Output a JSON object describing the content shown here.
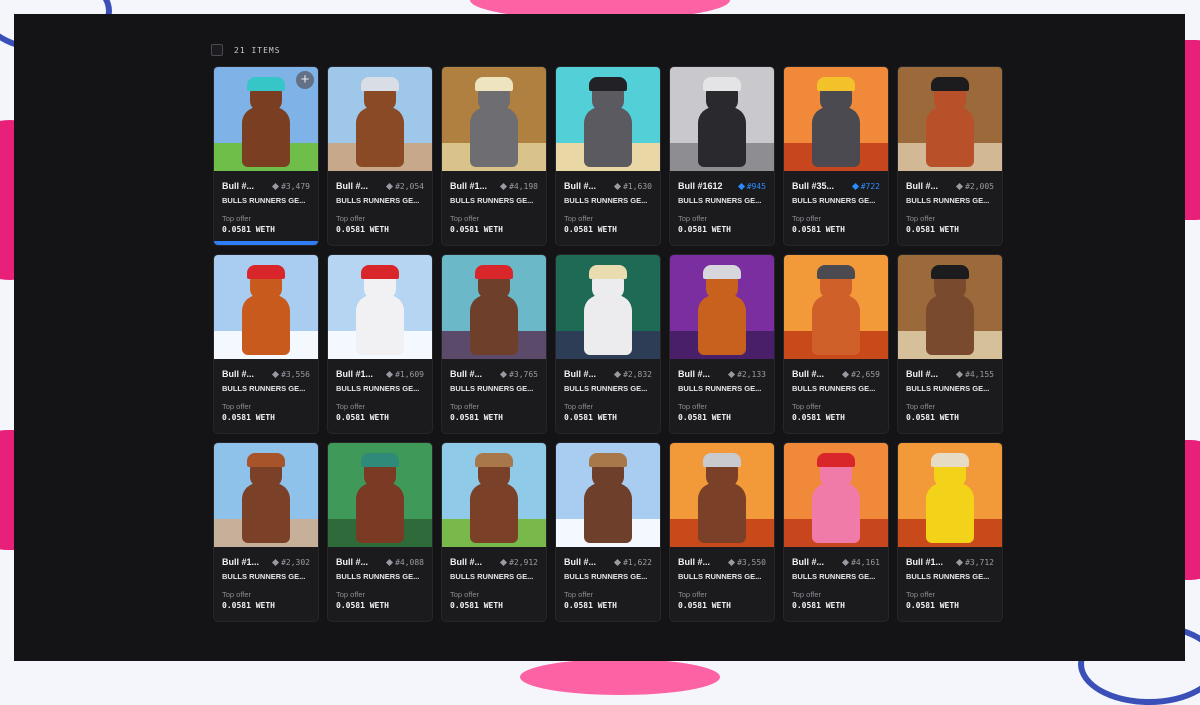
{
  "toolbar": {
    "items_count": "21 ITEMS"
  },
  "colors": {
    "accent": "#2e7cf6",
    "rank_blue": "#2b8cff",
    "frame_pink": "#e8207a"
  },
  "icons": {
    "add": "plus-icon",
    "rank": "diamond-icon"
  },
  "cards": [
    {
      "name": "Bull #...",
      "rank": "#3,479",
      "collection": "BULLS RUNNERS GE...",
      "offer_label": "Top offer",
      "offer_value": "0.0581 WETH",
      "bg": "#7fb3e8",
      "ground": "#6fbe4a",
      "body": "#7a3f22",
      "hat": "#36c6c8",
      "selected": true
    },
    {
      "name": "Bull #...",
      "rank": "#2,054",
      "collection": "BULLS RUNNERS GE...",
      "offer_label": "Top offer",
      "offer_value": "0.0581 WETH",
      "bg": "#9ec7ea",
      "ground": "#c7a88a",
      "body": "#8a4a26",
      "hat": "#d8dde6"
    },
    {
      "name": "Bull #1...",
      "rank": "#4,198",
      "collection": "BULLS RUNNERS GE...",
      "offer_label": "Top offer",
      "offer_value": "0.0581 WETH",
      "bg": "#b08040",
      "ground": "#d9c38a",
      "body": "#6e6e72",
      "hat": "#efe4c0"
    },
    {
      "name": "Bull #...",
      "rank": "#1,630",
      "collection": "BULLS RUNNERS GE...",
      "offer_label": "Top offer",
      "offer_value": "0.0581 WETH",
      "bg": "#53cfd8",
      "ground": "#e9d7a6",
      "body": "#5a5a60",
      "hat": "#222226"
    },
    {
      "name": "Bull #1612",
      "rank": "#945",
      "rank_blue": true,
      "collection": "BULLS RUNNERS GE...",
      "offer_label": "Top offer",
      "offer_value": "0.0581 WETH",
      "bg": "#c9c9cd",
      "ground": "#8d8d92",
      "body": "#2a2a2e",
      "hat": "#e4e4e6"
    },
    {
      "name": "Bull #35...",
      "rank": "#722",
      "rank_blue": true,
      "collection": "BULLS RUNNERS GE...",
      "offer_label": "Top offer",
      "offer_value": "0.0581 WETH",
      "bg": "#f08a3a",
      "ground": "#c8461e",
      "body": "#4a4a50",
      "hat": "#f3c12a"
    },
    {
      "name": "Bull #...",
      "rank": "#2,005",
      "collection": "BULLS RUNNERS GE...",
      "offer_label": "Top offer",
      "offer_value": "0.0581 WETH",
      "bg": "#9c6a3a",
      "ground": "#d2b894",
      "body": "#b8502a",
      "hat": "#1c1c1e"
    },
    {
      "name": "Bull #...",
      "rank": "#3,556",
      "collection": "BULLS RUNNERS GE...",
      "offer_label": "Top offer",
      "offer_value": "0.0581 WETH",
      "bg": "#a9cdf0",
      "ground": "#f4f8ff",
      "body": "#c85a1e",
      "hat": "#d8262a"
    },
    {
      "name": "Bull #1...",
      "rank": "#1,609",
      "collection": "BULLS RUNNERS GE...",
      "offer_label": "Top offer",
      "offer_value": "0.0581 WETH",
      "bg": "#b5d5f2",
      "ground": "#f4f8ff",
      "body": "#f1f1f3",
      "hat": "#d8262a"
    },
    {
      "name": "Bull #...",
      "rank": "#3,765",
      "collection": "BULLS RUNNERS GE...",
      "offer_label": "Top offer",
      "offer_value": "0.0581 WETH",
      "bg": "#6bb8c9",
      "ground": "#5c4a6a",
      "body": "#6e3f2a",
      "hat": "#d8262a"
    },
    {
      "name": "Bull #...",
      "rank": "#2,832",
      "collection": "BULLS RUNNERS GE...",
      "offer_label": "Top offer",
      "offer_value": "0.0581 WETH",
      "bg": "#1f6a55",
      "ground": "#2d3d55",
      "body": "#ececef",
      "hat": "#e8dcb0"
    },
    {
      "name": "Bull #...",
      "rank": "#2,133",
      "collection": "BULLS RUNNERS GE...",
      "offer_label": "Top offer",
      "offer_value": "0.0581 WETH",
      "bg": "#7a2ea0",
      "ground": "#4a1f6a",
      "body": "#c8601e",
      "hat": "#d6d6dc"
    },
    {
      "name": "Bull #...",
      "rank": "#2,659",
      "collection": "BULLS RUNNERS GE...",
      "offer_label": "Top offer",
      "offer_value": "0.0581 WETH",
      "bg": "#f29a3a",
      "ground": "#c84a1a",
      "body": "#d0602a",
      "hat": "#4a4a50"
    },
    {
      "name": "Bull #...",
      "rank": "#4,155",
      "collection": "BULLS RUNNERS GE...",
      "offer_label": "Top offer",
      "offer_value": "0.0581 WETH",
      "bg": "#9c6a3a",
      "ground": "#d6c09a",
      "body": "#7a4a2e",
      "hat": "#1c1c1e"
    },
    {
      "name": "Bull #1...",
      "rank": "#2,302",
      "collection": "BULLS RUNNERS GE...",
      "offer_label": "Top offer",
      "offer_value": "0.0581 WETH",
      "bg": "#8ec2ea",
      "ground": "#c7b09a",
      "body": "#7a4028",
      "hat": "#a8542a"
    },
    {
      "name": "Bull #...",
      "rank": "#4,088",
      "collection": "BULLS RUNNERS GE...",
      "offer_label": "Top offer",
      "offer_value": "0.0581 WETH",
      "bg": "#3f9a5a",
      "ground": "#2f6a3a",
      "body": "#7a3a24",
      "hat": "#2f8a7a"
    },
    {
      "name": "Bull #...",
      "rank": "#2,912",
      "collection": "BULLS RUNNERS GE...",
      "offer_label": "Top offer",
      "offer_value": "0.0581 WETH",
      "bg": "#8fcbe8",
      "ground": "#79b84a",
      "body": "#7a4028",
      "hat": "#a8784a"
    },
    {
      "name": "Bull #...",
      "rank": "#1,622",
      "collection": "BULLS RUNNERS GE...",
      "offer_label": "Top offer",
      "offer_value": "0.0581 WETH",
      "bg": "#a9cdf0",
      "ground": "#f4f8ff",
      "body": "#6e3f2a",
      "hat": "#a8784a"
    },
    {
      "name": "Bull #...",
      "rank": "#3,550",
      "collection": "BULLS RUNNERS GE...",
      "offer_label": "Top offer",
      "offer_value": "0.0581 WETH",
      "bg": "#f29a3a",
      "ground": "#c84a1a",
      "body": "#7a4028",
      "hat": "#c9c9d0"
    },
    {
      "name": "Bull #...",
      "rank": "#4,161",
      "collection": "BULLS RUNNERS GE...",
      "offer_label": "Top offer",
      "offer_value": "0.0581 WETH",
      "bg": "#f08a3a",
      "ground": "#c8461e",
      "body": "#f07aa8",
      "hat": "#d8262a"
    },
    {
      "name": "Bull #1...",
      "rank": "#3,712",
      "collection": "BULLS RUNNERS GE...",
      "offer_label": "Top offer",
      "offer_value": "0.0581 WETH",
      "bg": "#f29a3a",
      "ground": "#c84a1a",
      "body": "#f3d21a",
      "hat": "#e6dcc6"
    }
  ]
}
